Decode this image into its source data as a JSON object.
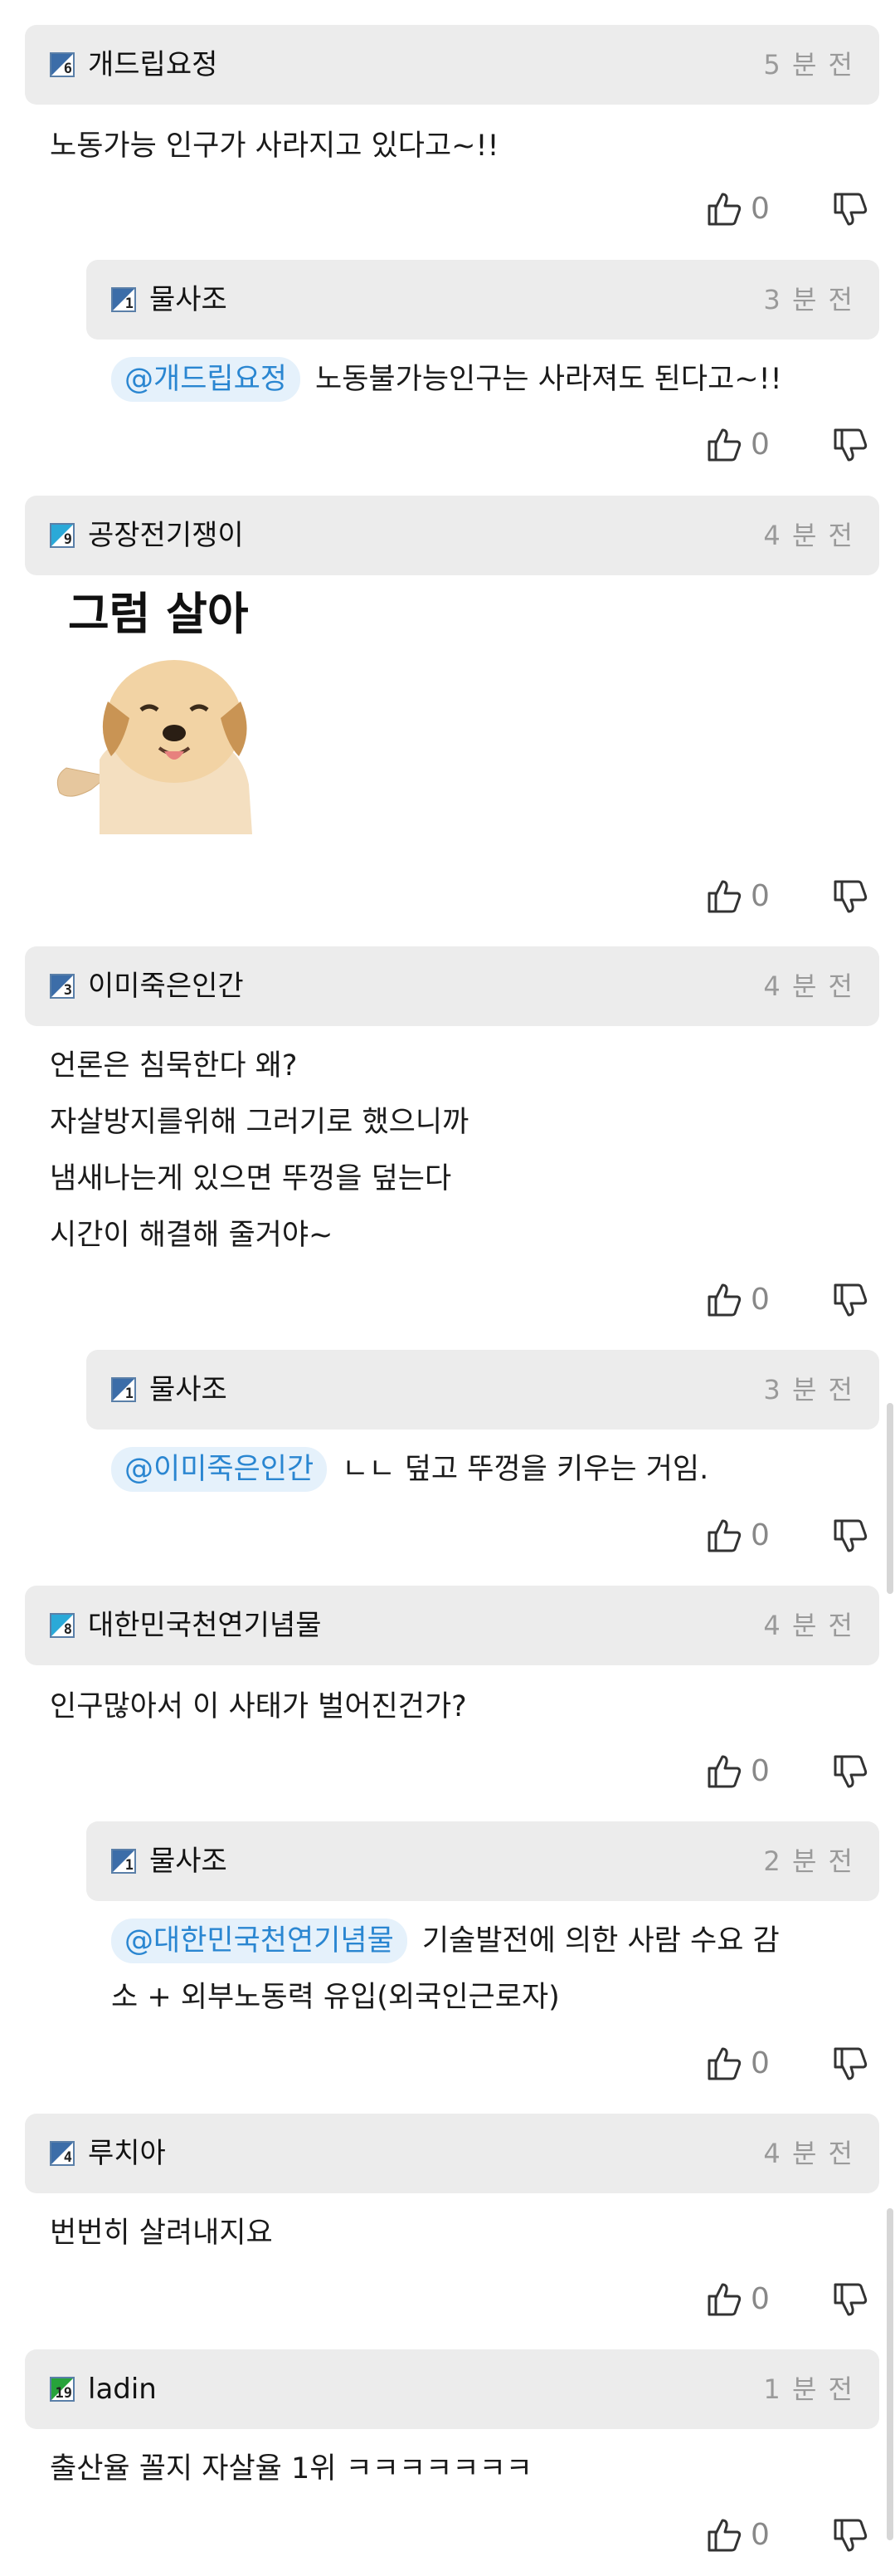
{
  "comments": [
    {
      "user": "개드립요정",
      "level": "6",
      "time": "5 분 전",
      "text": "노동가능 인구가 사라지고 있다고~!!",
      "likes": "0"
    },
    {
      "user": "물사조",
      "level": "1",
      "time": "3 분 전",
      "mention": "@개드립요정",
      "text": "노동불가능인구는 사라져도 된다고~!!",
      "likes": "0"
    },
    {
      "user": "공장전기쟁이",
      "level": "9",
      "time": "4 분 전",
      "sticker_text": "그럼 살아",
      "likes": "0"
    },
    {
      "user": "이미죽은인간",
      "level": "3",
      "time": "4 분 전",
      "lines": [
        "언론은 침묵한다 왜?",
        "자살방지를위해 그러기로 했으니까",
        "냄새나는게 있으면 뚜껑을 덮는다",
        "시간이 해결해 줄거야~"
      ],
      "likes": "0"
    },
    {
      "user": "물사조",
      "level": "1",
      "time": "3 분 전",
      "mention": "@이미죽은인간",
      "text": "ㄴㄴ 덮고 뚜껑을 키우는 거임.",
      "likes": "0"
    },
    {
      "user": "대한민국천연기념물",
      "level": "8",
      "time": "4 분 전",
      "text": "인구많아서 이 사태가 벌어진건가?",
      "likes": "0"
    },
    {
      "user": "물사조",
      "level": "1",
      "time": "2 분 전",
      "mention": "@대한민국천연기념물",
      "text": "기술발전에 의한 사람 수요 감",
      "text2": "소 + 외부노동력 유입(외국인근로자)",
      "likes": "0"
    },
    {
      "user": "루치아",
      "level": "4",
      "time": "4 분 전",
      "text": "번번히 살려내지요",
      "likes": "0"
    },
    {
      "user": "ladin",
      "level": "19",
      "time": "1 분 전",
      "text": "출산율 꼴지 자살율 1위 ㅋㅋㅋㅋㅋㅋㅋ",
      "likes": "0"
    }
  ],
  "colors": {
    "header_bg": "#ececec",
    "mention_bg": "#e5f1fb",
    "mention_text": "#2a86d1",
    "time_text": "#9a9a9a"
  }
}
